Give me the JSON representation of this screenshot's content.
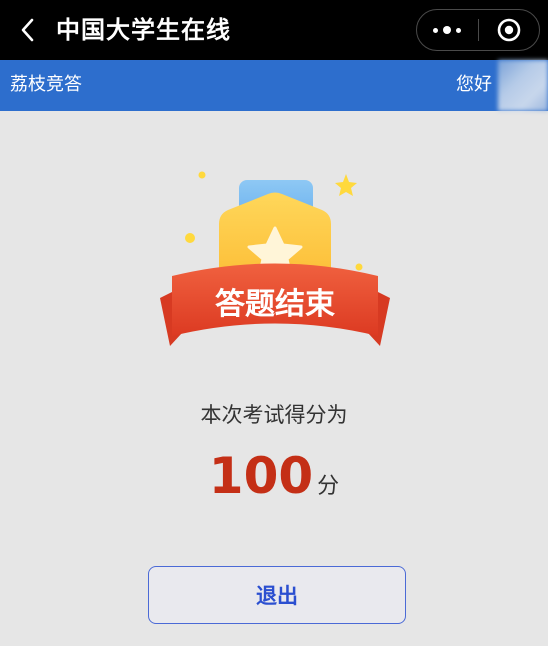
{
  "titlebar": {
    "title": "中国大学生在线"
  },
  "header": {
    "brand": "荔枝竞答",
    "greeting": "您好"
  },
  "result": {
    "badge_text": "答题结束",
    "label": "本次考试得分为",
    "score": "100",
    "unit": "分"
  },
  "actions": {
    "exit_label": "退出"
  },
  "colors": {
    "titlebar_bg": "#000000",
    "header_bg": "#2d6ecd",
    "score": "#c42f16",
    "exit_border": "#4b6ad6",
    "ribbon": "#e94a2e",
    "badge_gold": "#ffc53a"
  },
  "icons": {
    "back": "chevron-left-icon",
    "more": "more-dots-icon",
    "close": "target-circle-icon",
    "badge_star": "star-icon"
  }
}
